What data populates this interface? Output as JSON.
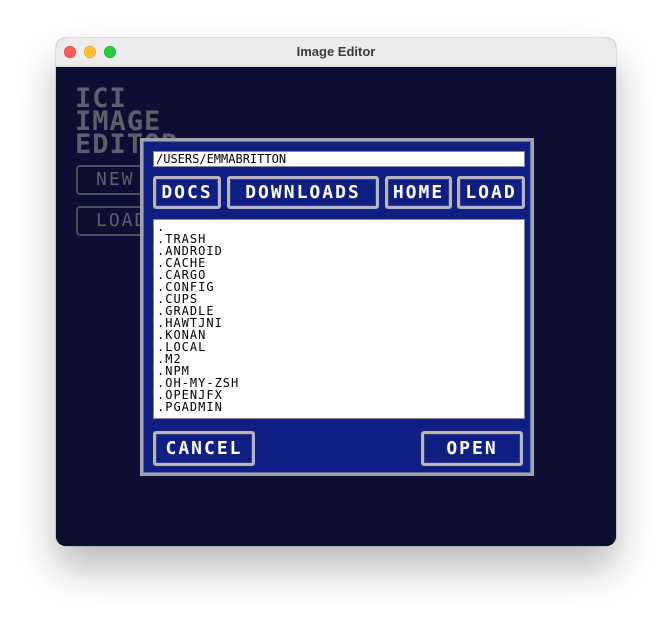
{
  "window": {
    "title": "Image Editor"
  },
  "app": {
    "title_lines": [
      "ICI",
      "IMAGE",
      "EDITOR"
    ],
    "new_button": "NEW",
    "load_button": "LOAD"
  },
  "dialog": {
    "path": "/USERS/EMMABRITTON",
    "shortcuts": {
      "docs": "DOCS",
      "downloads": "DOWNLOADS",
      "home": "HOME",
      "load": "LOAD"
    },
    "files": [
      ".",
      ".TRASH",
      ".ANDROID",
      ".CACHE",
      ".CARGO",
      ".CONFIG",
      ".CUPS",
      ".GRADLE",
      ".HAWTJNI",
      ".KONAN",
      ".LOCAL",
      ".M2",
      ".NPM",
      ".OH-MY-ZSH",
      ".OPENJFX",
      ".PGADMIN"
    ],
    "cancel_button": "CANCEL",
    "open_button": "OPEN"
  },
  "colors": {
    "background": "#0b1032",
    "dialog": "#0f1f84",
    "button_border": "#b7b7b7",
    "muted_text": "#5f5f6a"
  }
}
